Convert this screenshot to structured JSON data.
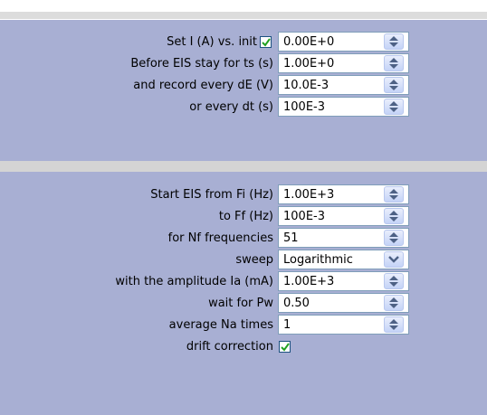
{
  "init": {
    "set_label": "Set  I (A) vs. init",
    "set_checked": true,
    "set_value": "0.00E+0",
    "before_label": "Before EIS  stay for ts (s)",
    "before_value": "1.00E+0",
    "record_label": "and record every dE (V)",
    "record_value": "10.0E-3",
    "every_dt_label": "or every dt (s)",
    "every_dt_value": "100E-3"
  },
  "eis": {
    "start_label": "Start EIS from  Fi (Hz)",
    "start_value": "1.00E+3",
    "to_label": "to Ff (Hz)",
    "to_value": "100E-3",
    "nf_label": "for Nf frequencies",
    "nf_value": "51",
    "sweep_label": "sweep",
    "sweep_value": "Logarithmic",
    "amplitude_label": "with the amplitude Ia (mA)",
    "amplitude_value": "1.00E+3",
    "wait_label": "wait for Pw",
    "wait_value": "0.50",
    "average_label": "average Na times",
    "average_value": "1",
    "drift_label": "drift correction",
    "drift_checked": true
  },
  "colors": {
    "panel_bg": "#a8afd3",
    "field_border": "#7f9db9",
    "check_green": "#21a121"
  }
}
